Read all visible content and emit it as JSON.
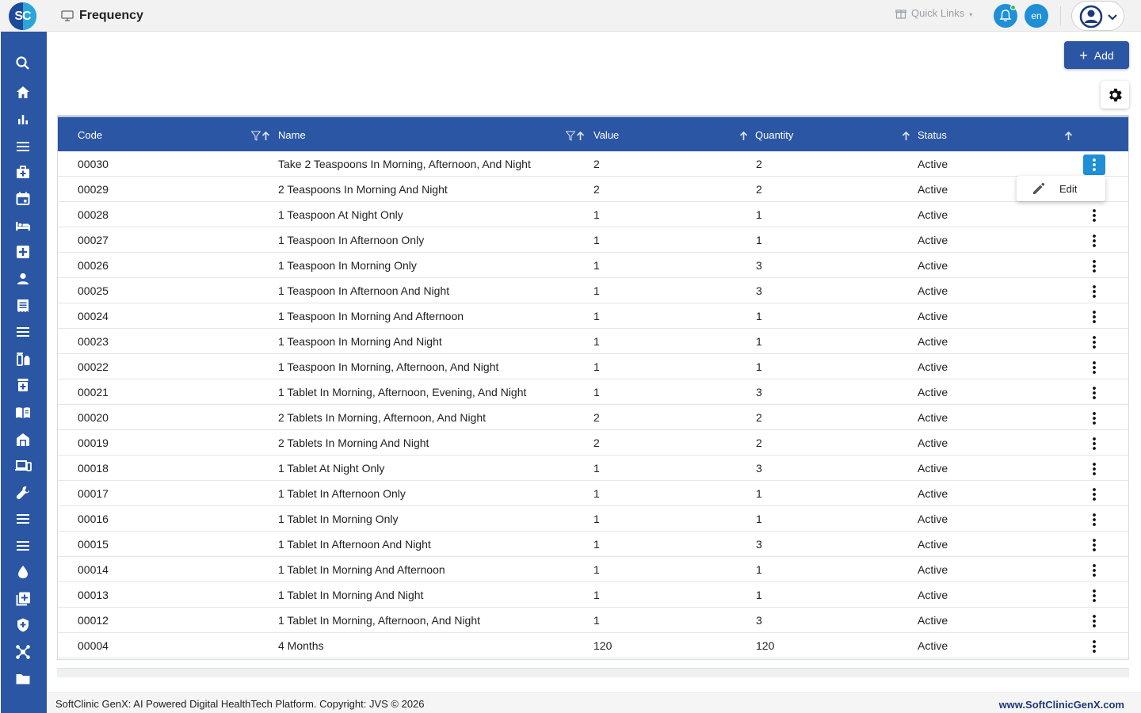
{
  "app": {
    "logo_text": "SC",
    "page_title": "Frequency"
  },
  "header": {
    "quick_links_label": "Quick Links",
    "language": "en"
  },
  "sidebar": {
    "items": [
      {
        "icon": "search-icon"
      },
      {
        "icon": "home-icon"
      },
      {
        "icon": "bar-chart-icon"
      },
      {
        "icon": "menu-icon"
      },
      {
        "icon": "medical-bag-icon"
      },
      {
        "icon": "calendar-icon"
      },
      {
        "icon": "bed-icon"
      },
      {
        "icon": "medical-plus-icon"
      },
      {
        "icon": "person-icon"
      },
      {
        "icon": "receipt-icon"
      },
      {
        "icon": "menu-icon"
      },
      {
        "icon": "medication-icon"
      },
      {
        "icon": "pharmacy-icon"
      },
      {
        "icon": "book-icon"
      },
      {
        "icon": "store-icon"
      },
      {
        "icon": "devices-icon"
      },
      {
        "icon": "wrench-icon"
      },
      {
        "icon": "menu-icon"
      },
      {
        "icon": "menu-icon"
      },
      {
        "icon": "drop-icon"
      },
      {
        "icon": "add-library-icon"
      },
      {
        "icon": "shield-icon"
      },
      {
        "icon": "hub-icon"
      },
      {
        "icon": "folder-icon"
      }
    ]
  },
  "toolbar": {
    "add_label": "Add"
  },
  "table": {
    "columns": [
      "Code",
      "Name",
      "Value",
      "Quantity",
      "Status"
    ],
    "rows": [
      {
        "code": "00030",
        "name": "Take 2 Teaspoons In Morning, Afternoon, And Night",
        "value": "2",
        "quantity": "2",
        "status": "Active"
      },
      {
        "code": "00029",
        "name": "2 Teaspoons In Morning And Night",
        "value": "2",
        "quantity": "2",
        "status": "Active"
      },
      {
        "code": "00028",
        "name": "1 Teaspoon At Night Only",
        "value": "1",
        "quantity": "1",
        "status": "Active"
      },
      {
        "code": "00027",
        "name": "1 Teaspoon In Afternoon Only",
        "value": "1",
        "quantity": "1",
        "status": "Active"
      },
      {
        "code": "00026",
        "name": "1 Teaspoon In Morning Only",
        "value": "1",
        "quantity": "3",
        "status": "Active"
      },
      {
        "code": "00025",
        "name": "1 Teaspoon In Afternoon And Night",
        "value": "1",
        "quantity": "3",
        "status": "Active"
      },
      {
        "code": "00024",
        "name": "1 Teaspoon In Morning And Afternoon",
        "value": "1",
        "quantity": "1",
        "status": "Active"
      },
      {
        "code": "00023",
        "name": "1 Teaspoon In Morning And Night",
        "value": "1",
        "quantity": "1",
        "status": "Active"
      },
      {
        "code": "00022",
        "name": "1 Teaspoon In Morning, Afternoon, And Night",
        "value": "1",
        "quantity": "1",
        "status": "Active"
      },
      {
        "code": "00021",
        "name": "1 Tablet In Morning, Afternoon, Evening, And Night",
        "value": "1",
        "quantity": "3",
        "status": "Active"
      },
      {
        "code": "00020",
        "name": "2 Tablets In Morning, Afternoon, And Night",
        "value": "2",
        "quantity": "2",
        "status": "Active"
      },
      {
        "code": "00019",
        "name": "2 Tablets In Morning And Night",
        "value": "2",
        "quantity": "2",
        "status": "Active"
      },
      {
        "code": "00018",
        "name": "1 Tablet At Night Only",
        "value": "1",
        "quantity": "3",
        "status": "Active"
      },
      {
        "code": "00017",
        "name": "1 Tablet In Afternoon Only",
        "value": "1",
        "quantity": "1",
        "status": "Active"
      },
      {
        "code": "00016",
        "name": "1 Tablet In Morning Only",
        "value": "1",
        "quantity": "1",
        "status": "Active"
      },
      {
        "code": "00015",
        "name": "1 Tablet In Afternoon And Night",
        "value": "1",
        "quantity": "3",
        "status": "Active"
      },
      {
        "code": "00014",
        "name": "1 Tablet In Morning And Afternoon",
        "value": "1",
        "quantity": "1",
        "status": "Active"
      },
      {
        "code": "00013",
        "name": "1 Tablet In Morning And Night",
        "value": "1",
        "quantity": "1",
        "status": "Active"
      },
      {
        "code": "00012",
        "name": "1 Tablet In Morning, Afternoon, And Night",
        "value": "1",
        "quantity": "3",
        "status": "Active"
      },
      {
        "code": "00004",
        "name": "4 Months",
        "value": "120",
        "quantity": "120",
        "status": "Active"
      }
    ]
  },
  "row_menu": {
    "edit_label": "Edit"
  },
  "footer": {
    "copyright": "SoftClinic GenX: AI Powered Digital HealthTech Platform. Copyright: JVS © 2026",
    "website": "www.SoftClinicGenX.com"
  },
  "colors": {
    "primary": "#2a56a4",
    "accent": "#1f8fd6",
    "online": "#3cc15b"
  }
}
